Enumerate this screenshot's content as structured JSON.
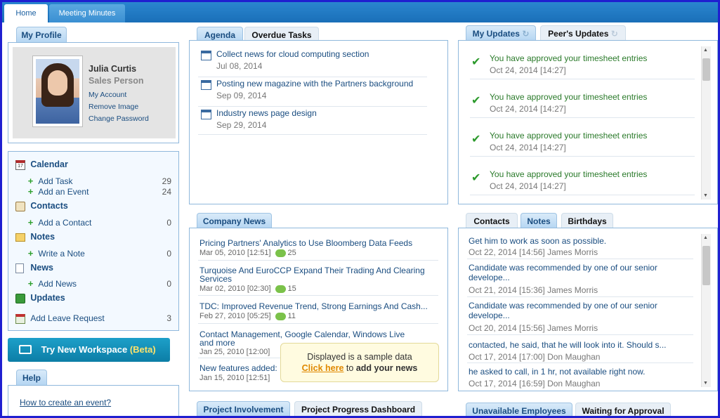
{
  "top_tabs": [
    {
      "label": "Home"
    },
    {
      "label": "Meeting Minutes"
    }
  ],
  "profile": {
    "tab": "My Profile",
    "name": "Julia Curtis",
    "role": "Sales Person",
    "links": [
      "My Account",
      "Remove Image",
      "Change Password"
    ]
  },
  "nav": {
    "calendar": "Calendar",
    "add_task": "Add Task",
    "add_task_count": "29",
    "add_event": "Add an Event",
    "add_event_count": "24",
    "contacts": "Contacts",
    "add_contact": "Add a Contact",
    "add_contact_count": "0",
    "notes": "Notes",
    "write_note": "Write a Note",
    "write_note_count": "0",
    "news": "News",
    "add_news": "Add News",
    "add_news_count": "0",
    "updates": "Updates",
    "leave": "Add Leave Request",
    "leave_count": "3"
  },
  "workspace": {
    "label": "Try New Workspace",
    "beta": "(Beta)"
  },
  "help": {
    "tab": "Help",
    "link": "How to create an event?"
  },
  "agenda": {
    "tabs": [
      "Agenda",
      "Overdue Tasks"
    ],
    "items": [
      {
        "title": "Collect news for cloud computing section",
        "date": "Jul 08, 2014"
      },
      {
        "title": "Posting new magazine with the Partners background",
        "date": "Sep 09, 2014"
      },
      {
        "title": "Industry news page design",
        "date": "Sep 29, 2014"
      }
    ]
  },
  "updates": {
    "tabs": [
      "My Updates",
      "Peer's Updates"
    ],
    "items": [
      {
        "text": "You have approved your timesheet entries",
        "date": "Oct 24, 2014 [14:27]"
      },
      {
        "text": "You have approved your timesheet entries",
        "date": "Oct 24, 2014 [14:27]"
      },
      {
        "text": "You have approved your timesheet entries",
        "date": "Oct 24, 2014 [14:27]"
      },
      {
        "text": "You have approved your timesheet entries",
        "date": "Oct 24, 2014 [14:27]"
      }
    ]
  },
  "company_news": {
    "tab": "Company News",
    "items": [
      {
        "title": "Pricing Partners' Analytics to Use Bloomberg Data Feeds",
        "date": "Mar 05, 2010 [12:51]",
        "comments": "25"
      },
      {
        "title": "Turquoise And EuroCCP Expand Their Trading And Clearing Services",
        "date": "Mar 02, 2010 [02:30]",
        "comments": "15"
      },
      {
        "title": "TDC: Improved Revenue Trend, Strong Earnings And Cash...",
        "date": "Feb 27, 2010 [05:25]",
        "comments": "11"
      },
      {
        "title": "Contact Management, Google Calendar, Windows Live and more",
        "date": "Jan 25, 2010 [12:00]",
        "comments": ""
      },
      {
        "title": "New features added:",
        "date": "Jan 15, 2010 [12:51]",
        "comments": ""
      }
    ],
    "tooltip_line1": "Displayed is a sample data",
    "tooltip_link": "Click here",
    "tooltip_to": "to",
    "tooltip_rest": "add your news"
  },
  "notes": {
    "tabs": [
      "Contacts",
      "Notes",
      "Birthdays"
    ],
    "items": [
      {
        "text": "Get him to work as soon as possible.",
        "date": "Oct 22, 2014 [14:56]",
        "author": "James Morris"
      },
      {
        "text": "Candidate was recommended by one of our senior develope...",
        "date": "Oct 21, 2014 [15:36]",
        "author": "James Morris"
      },
      {
        "text": "Candidate was recommended by one of our senior develope...",
        "date": "Oct 20, 2014 [15:56]",
        "author": "James Morris"
      },
      {
        "text": "contacted, he said, that he will look into it. Should s...",
        "date": "Oct 17, 2014 [17:00]",
        "author": "Don Maughan"
      },
      {
        "text": "he asked to call, in 1 hr, not available right now.",
        "date": "Oct 17, 2014 [16:59]",
        "author": "Don Maughan"
      }
    ]
  },
  "bottom_tabs": {
    "project": [
      "Project Involvement",
      "Project Progress Dashboard"
    ],
    "employees": [
      "Unavailable Employees",
      "Waiting for Approval"
    ]
  },
  "colors": {
    "accent": "#1a6fb8",
    "frame": "#1f1fd0",
    "link": "#1a4d80",
    "positive": "#2c9a2c"
  }
}
